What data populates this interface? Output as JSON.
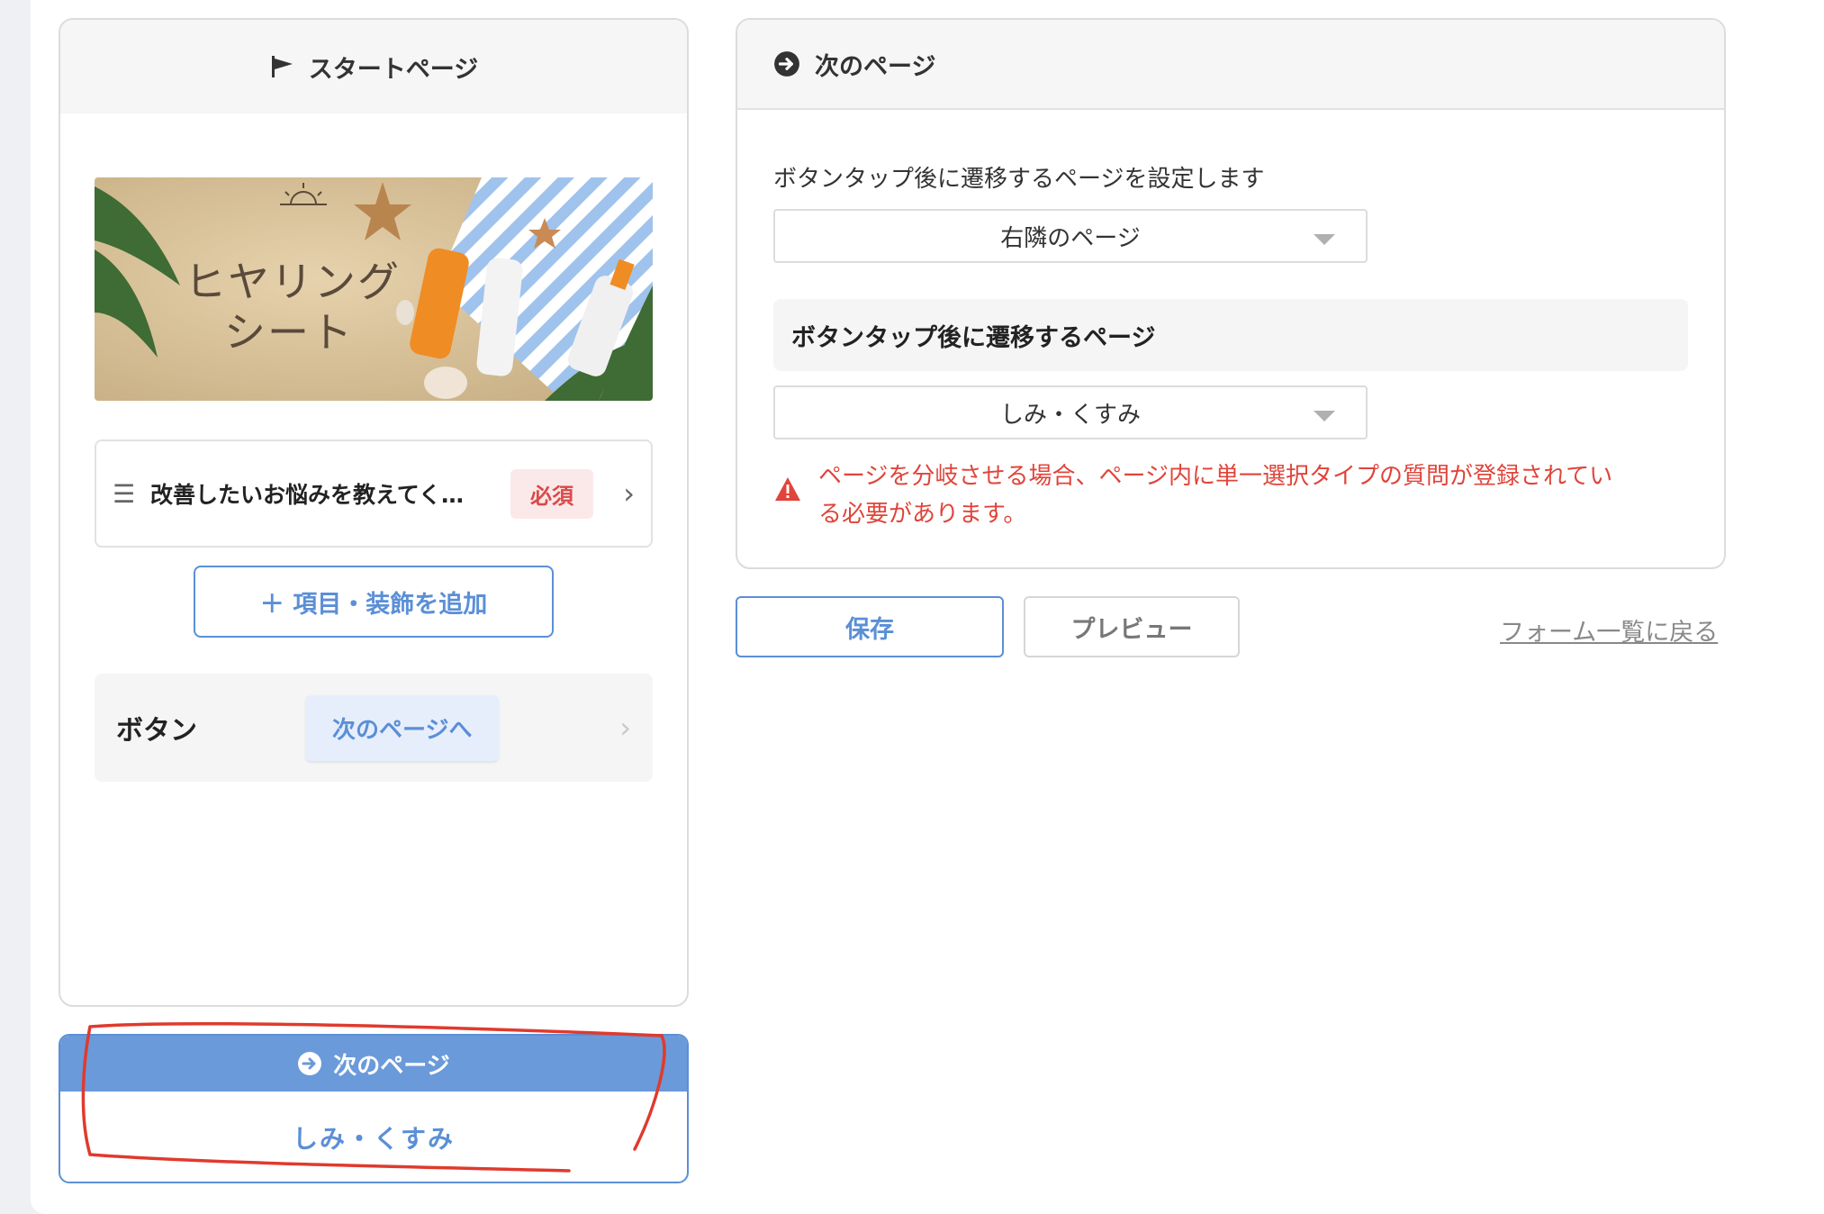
{
  "start_panel": {
    "title": "スタートページ",
    "hero_title_line1": "ヒヤリング",
    "hero_title_line2": "シート",
    "question_label": "改善したいお悩みを教えてく…",
    "required_label": "必須",
    "add_item_label": "＋ 項目・装飾を追加",
    "button_label": "ボタン",
    "next_page_button_label": "次のページへ"
  },
  "next_card": {
    "header_label": "次のページ",
    "target_label": "しみ・くすみ"
  },
  "next_panel": {
    "title": "次のページ",
    "description": "ボタンタップ後に遷移するページを設定します",
    "transition_select_value": "右隣のページ",
    "sub_header": "ボタンタップ後に遷移するページ",
    "target_select_value": "しみ・くすみ",
    "error_line1": "ページを分岐させる場合、ページ内に単一選択タイプの質問が登録されてい",
    "error_line2": "る必要があります。"
  },
  "actions": {
    "save_label": "保存",
    "preview_label": "プレビュー",
    "back_label": "フォーム一覧に戻る"
  },
  "colors": {
    "accent": "#5b8fd6",
    "error": "#e0443a",
    "annotation": "#e03a2e"
  }
}
